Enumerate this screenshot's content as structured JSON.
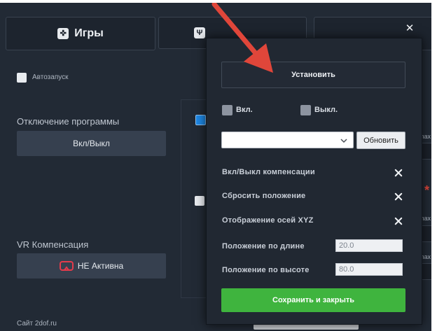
{
  "tabs": [
    {
      "label": "Игры",
      "icon": "gamepad-icon"
    },
    {
      "label": "",
      "icon": "usb-icon"
    },
    {
      "label": ""
    }
  ],
  "close_glyph": "✕",
  "background": {
    "autostart_label": "Автозапуск",
    "program_off_label": "Отключение программы",
    "on_off_button": "Вкл/Выкл",
    "vr_label": "VR Компенсация",
    "vr_button": "НЕ Активна",
    "footer_site": "Сайт 2dof.ru",
    "max_labels": [
      "max",
      "max",
      "max"
    ],
    "required_mark": "*"
  },
  "popup": {
    "install_button": "Установить",
    "on_label": "Вкл.",
    "off_label": "Выкл.",
    "select_value": "",
    "refresh_button": "Обновить",
    "rows": [
      {
        "label": "Вкл/Выкл компенсации"
      },
      {
        "label": "Сбросить положение"
      },
      {
        "label": "Отображение осей XYZ"
      }
    ],
    "length_label": "Положение по длине",
    "length_value": "20.0",
    "height_label": "Положение по высоте",
    "height_value": "80.0",
    "save_button": "Сохранить и закрыть"
  },
  "colors": {
    "accent_blue": "#1e88e5",
    "save_green": "#3fb43e",
    "arrow_red": "#e0463a",
    "vr_icon_red": "#e53b4b"
  }
}
